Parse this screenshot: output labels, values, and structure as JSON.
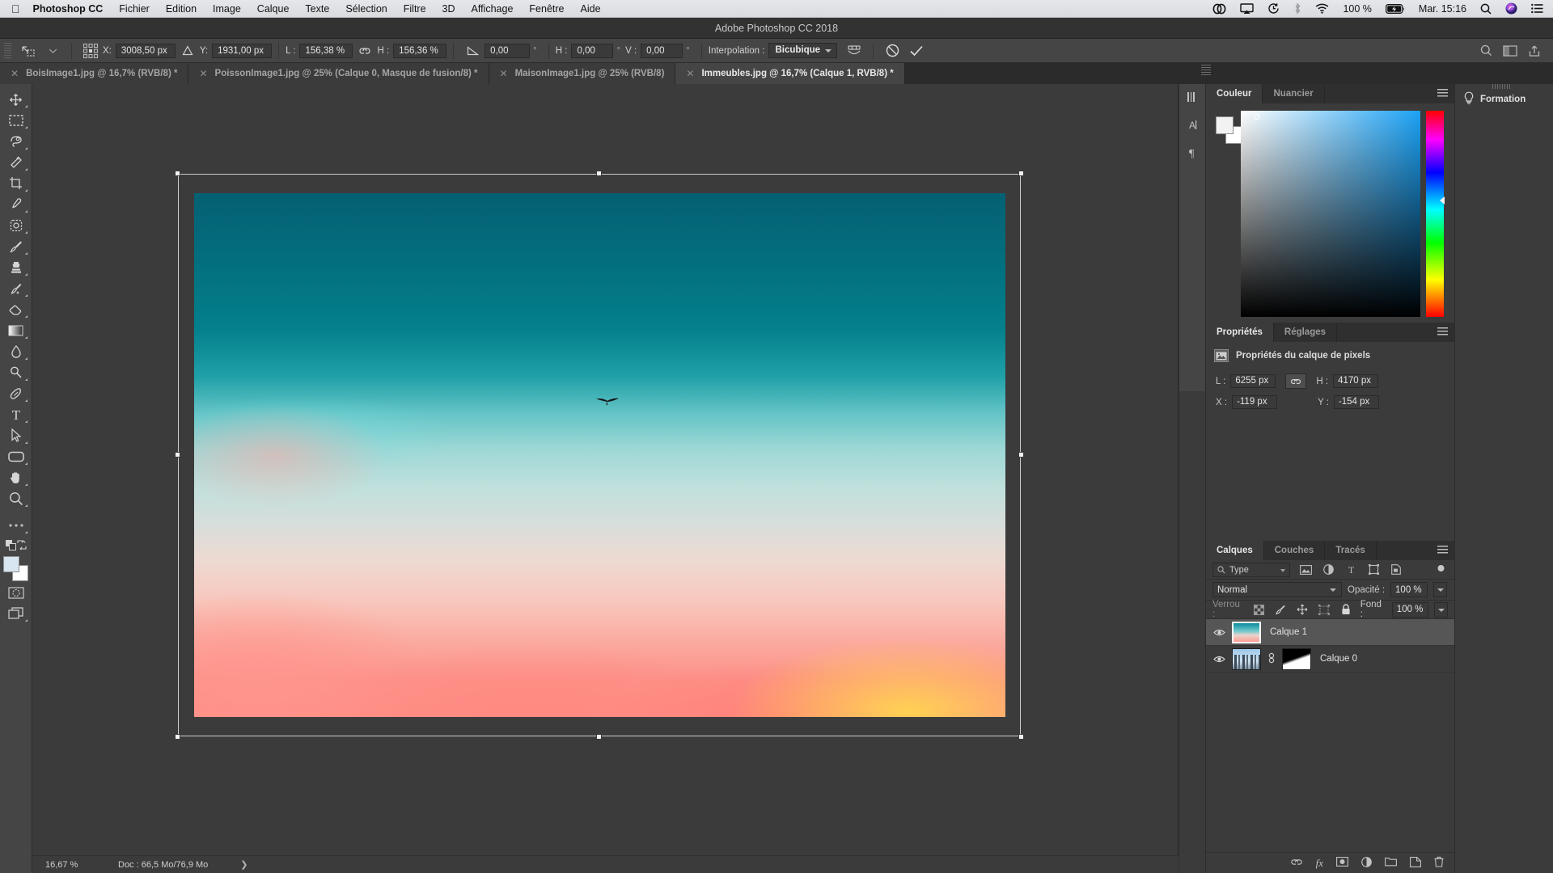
{
  "macbar": {
    "apple_icon": "apple-icon",
    "items": [
      {
        "label": "Photoshop CC",
        "bold": true
      },
      {
        "label": "Fichier",
        "bold": false
      },
      {
        "label": "Edition",
        "bold": false
      },
      {
        "label": "Image",
        "bold": false
      },
      {
        "label": "Calque",
        "bold": false
      },
      {
        "label": "Texte",
        "bold": false
      },
      {
        "label": "Sélection",
        "bold": false
      },
      {
        "label": "Filtre",
        "bold": false
      },
      {
        "label": "3D",
        "bold": false
      },
      {
        "label": "Affichage",
        "bold": false
      },
      {
        "label": "Fenêtre",
        "bold": false
      },
      {
        "label": "Aide",
        "bold": false
      }
    ],
    "status": {
      "creative_cloud_icon": "creative-cloud-icon",
      "airplay_icon": "airplay-icon",
      "timemachine_icon": "time-machine-icon",
      "bluetooth_icon": "bluetooth-icon",
      "wifi_icon": "wifi-icon",
      "battery_percent": "100 %",
      "battery_icon": "battery-charging-icon",
      "clock": "Mar. 15:16",
      "spotlight_icon": "search-icon",
      "siri_icon": "siri-icon",
      "notification_icon": "notification-center-icon"
    }
  },
  "window": {
    "title": "Adobe Photoshop CC 2018"
  },
  "options_bar": {
    "tool_icon": "move-tool-icon",
    "tool_preset_caret": "chevron-down-icon",
    "reference_point_icon": "reference-point-grid-icon",
    "x_label": "X:",
    "x_value": "3008,50 px",
    "delta_icon": "delta-icon",
    "y_label": "Y:",
    "y_value": "1931,00 px",
    "w_label": "L :",
    "w_value": "156,38 %",
    "link_icon": "link-icon",
    "h_label": "H :",
    "h_value": "156,36 %",
    "angle_icon": "angle-icon",
    "angle_value": "0,00",
    "angle_unit": "°",
    "skew_h_label": "H :",
    "skew_h_value": "0,00",
    "skew_h_unit": "°",
    "skew_v_label": "V :",
    "skew_v_value": "0,00",
    "skew_v_unit": "°",
    "interpolation_label": "Interpolation :",
    "interpolation_value": "Bicubique",
    "warp_icon": "warp-mode-icon",
    "cancel_icon": "cancel-transform-icon",
    "commit_icon": "commit-transform-icon",
    "search_icon": "search-icon",
    "arrange_icon": "arrange-documents-icon",
    "share_icon": "share-icon"
  },
  "tabs": [
    {
      "label": "BoisImage1.jpg @ 16,7% (RVB/8) *",
      "active": false,
      "close_icon": "close-icon"
    },
    {
      "label": "PoissonImage1.jpg @ 25% (Calque 0, Masque de fusion/8) *",
      "active": false,
      "close_icon": "close-icon"
    },
    {
      "label": "MaisonImage1.jpg @ 25% (RVB/8)",
      "active": false,
      "close_icon": "close-icon"
    },
    {
      "label": "Immeubles.jpg @ 16,7% (Calque 1, RVB/8) *",
      "active": true,
      "close_icon": "close-icon"
    }
  ],
  "toolbar": [
    {
      "name": "move-tool",
      "icon": "move-icon"
    },
    {
      "name": "rectangular-marquee-tool",
      "icon": "marquee-icon"
    },
    {
      "name": "lasso-tool",
      "icon": "lasso-icon"
    },
    {
      "name": "quick-selection-tool",
      "icon": "magic-wand-icon"
    },
    {
      "name": "crop-tool",
      "icon": "crop-icon"
    },
    {
      "name": "eyedropper-tool",
      "icon": "eyedropper-icon"
    },
    {
      "name": "healing-brush-tool",
      "icon": "healing-brush-icon"
    },
    {
      "name": "brush-tool",
      "icon": "brush-icon"
    },
    {
      "name": "clone-stamp-tool",
      "icon": "clone-stamp-icon"
    },
    {
      "name": "history-brush-tool",
      "icon": "history-brush-icon"
    },
    {
      "name": "eraser-tool",
      "icon": "eraser-icon"
    },
    {
      "name": "gradient-tool",
      "icon": "gradient-icon"
    },
    {
      "name": "blur-tool",
      "icon": "blur-icon"
    },
    {
      "name": "dodge-tool",
      "icon": "dodge-icon"
    },
    {
      "name": "pen-tool",
      "icon": "pen-icon"
    },
    {
      "name": "type-tool",
      "icon": "type-icon"
    },
    {
      "name": "path-selection-tool",
      "icon": "path-arrow-icon"
    },
    {
      "name": "rectangle-tool",
      "icon": "rounded-rectangle-icon"
    },
    {
      "name": "hand-tool",
      "icon": "hand-icon"
    },
    {
      "name": "zoom-tool",
      "icon": "magnifier-icon"
    },
    {
      "name": "edit-toolbar",
      "icon": "ellipsis-icon"
    }
  ],
  "toolbar_bottom": {
    "default_colors_icon": "default-colors-icon",
    "swap_colors_icon": "swap-colors-icon",
    "foreground_color": "#d8e6f2",
    "background_color": "#ffffff",
    "quick_mask_icon": "quick-mask-icon",
    "screen_mode_icon": "screen-mode-icon"
  },
  "canvas": {
    "transform_handles_icon": "transform-handle",
    "bird_icon": "flying-bird"
  },
  "status_bar": {
    "zoom": "16,67 %",
    "doc_info": "Doc : 66,5 Mo/76,9 Mo",
    "expand_icon": "chevron-right-icon"
  },
  "rail_icons": [
    {
      "name": "character-panel-icon",
      "glyph": "‖"
    },
    {
      "name": "paragraph-styles-icon",
      "glyph": "A"
    },
    {
      "name": "paragraph-panel-icon",
      "glyph": "¶"
    }
  ],
  "color_panel": {
    "tabs": [
      {
        "label": "Couleur",
        "active": true
      },
      {
        "label": "Nuancier",
        "active": false
      }
    ],
    "menu_icon": "panel-menu-icon",
    "foreground_swatch": "#f2f2f2",
    "background_swatch": "#ffffff",
    "spectrum_icon": "color-field",
    "hue_ramp_icon": "hue-ramp"
  },
  "properties_panel": {
    "tabs": [
      {
        "label": "Propriétés",
        "active": true
      },
      {
        "label": "Réglages",
        "active": false
      }
    ],
    "menu_icon": "panel-menu-icon",
    "header_icon": "pixel-layer-icon",
    "header_title": "Propriétés du calque de pixels",
    "width_label": "L :",
    "width_value": "6255 px",
    "link_icon": "link-dimensions-icon",
    "height_label": "H :",
    "height_value": "4170 px",
    "x_label": "X :",
    "x_value": "-119 px",
    "y_label": "Y :",
    "y_value": "-154 px"
  },
  "layers_panel": {
    "tabs": [
      {
        "label": "Calques",
        "active": true
      },
      {
        "label": "Couches",
        "active": false
      },
      {
        "label": "Tracés",
        "active": false
      }
    ],
    "menu_icon": "panel-menu-icon",
    "filter_search_icon": "search-icon",
    "filter_type_label": "Type",
    "filter_icons": [
      {
        "name": "filter-pixel-icon",
        "glyph": "▣"
      },
      {
        "name": "filter-adjustment-icon",
        "glyph": "◑"
      },
      {
        "name": "filter-type-icon",
        "glyph": "T"
      },
      {
        "name": "filter-shape-icon",
        "glyph": "⬚"
      },
      {
        "name": "filter-smart-object-icon",
        "glyph": "❐"
      }
    ],
    "filter_toggle_icon": "filter-toggle-switch",
    "blend_mode": "Normal",
    "opacity_label": "Opacité :",
    "opacity_value": "100 %",
    "lock_label": "Verrou :",
    "lock_icons": [
      {
        "name": "lock-transparency-icon",
        "glyph": "▦"
      },
      {
        "name": "lock-image-icon",
        "glyph": "✎"
      },
      {
        "name": "lock-position-icon",
        "glyph": "✥"
      },
      {
        "name": "lock-artboard-icon",
        "glyph": "⬚"
      },
      {
        "name": "lock-all-icon",
        "glyph": "🔒"
      }
    ],
    "fill_label": "Fond :",
    "fill_value": "100 %",
    "layers": [
      {
        "name": "Calque 1",
        "selected": true,
        "visible": true,
        "thumb": "sky-gradient",
        "has_mask": false
      },
      {
        "name": "Calque 0",
        "selected": false,
        "visible": true,
        "thumb": "city-buildings",
        "has_mask": true,
        "link_icon": "mask-link-icon"
      }
    ],
    "footer_icons": [
      {
        "name": "link-layers-icon",
        "glyph": "⧉"
      },
      {
        "name": "layer-style-icon",
        "glyph": "fx"
      },
      {
        "name": "add-layer-mask-icon",
        "glyph": "▣"
      },
      {
        "name": "new-fill-adjustment-icon",
        "glyph": "◑"
      },
      {
        "name": "new-group-icon",
        "glyph": "🗀"
      },
      {
        "name": "new-layer-icon",
        "glyph": "⧉"
      },
      {
        "name": "delete-layer-icon",
        "glyph": "🗑"
      }
    ]
  },
  "formation_panel": {
    "icon": "lightbulb-icon",
    "title": "Formation"
  }
}
